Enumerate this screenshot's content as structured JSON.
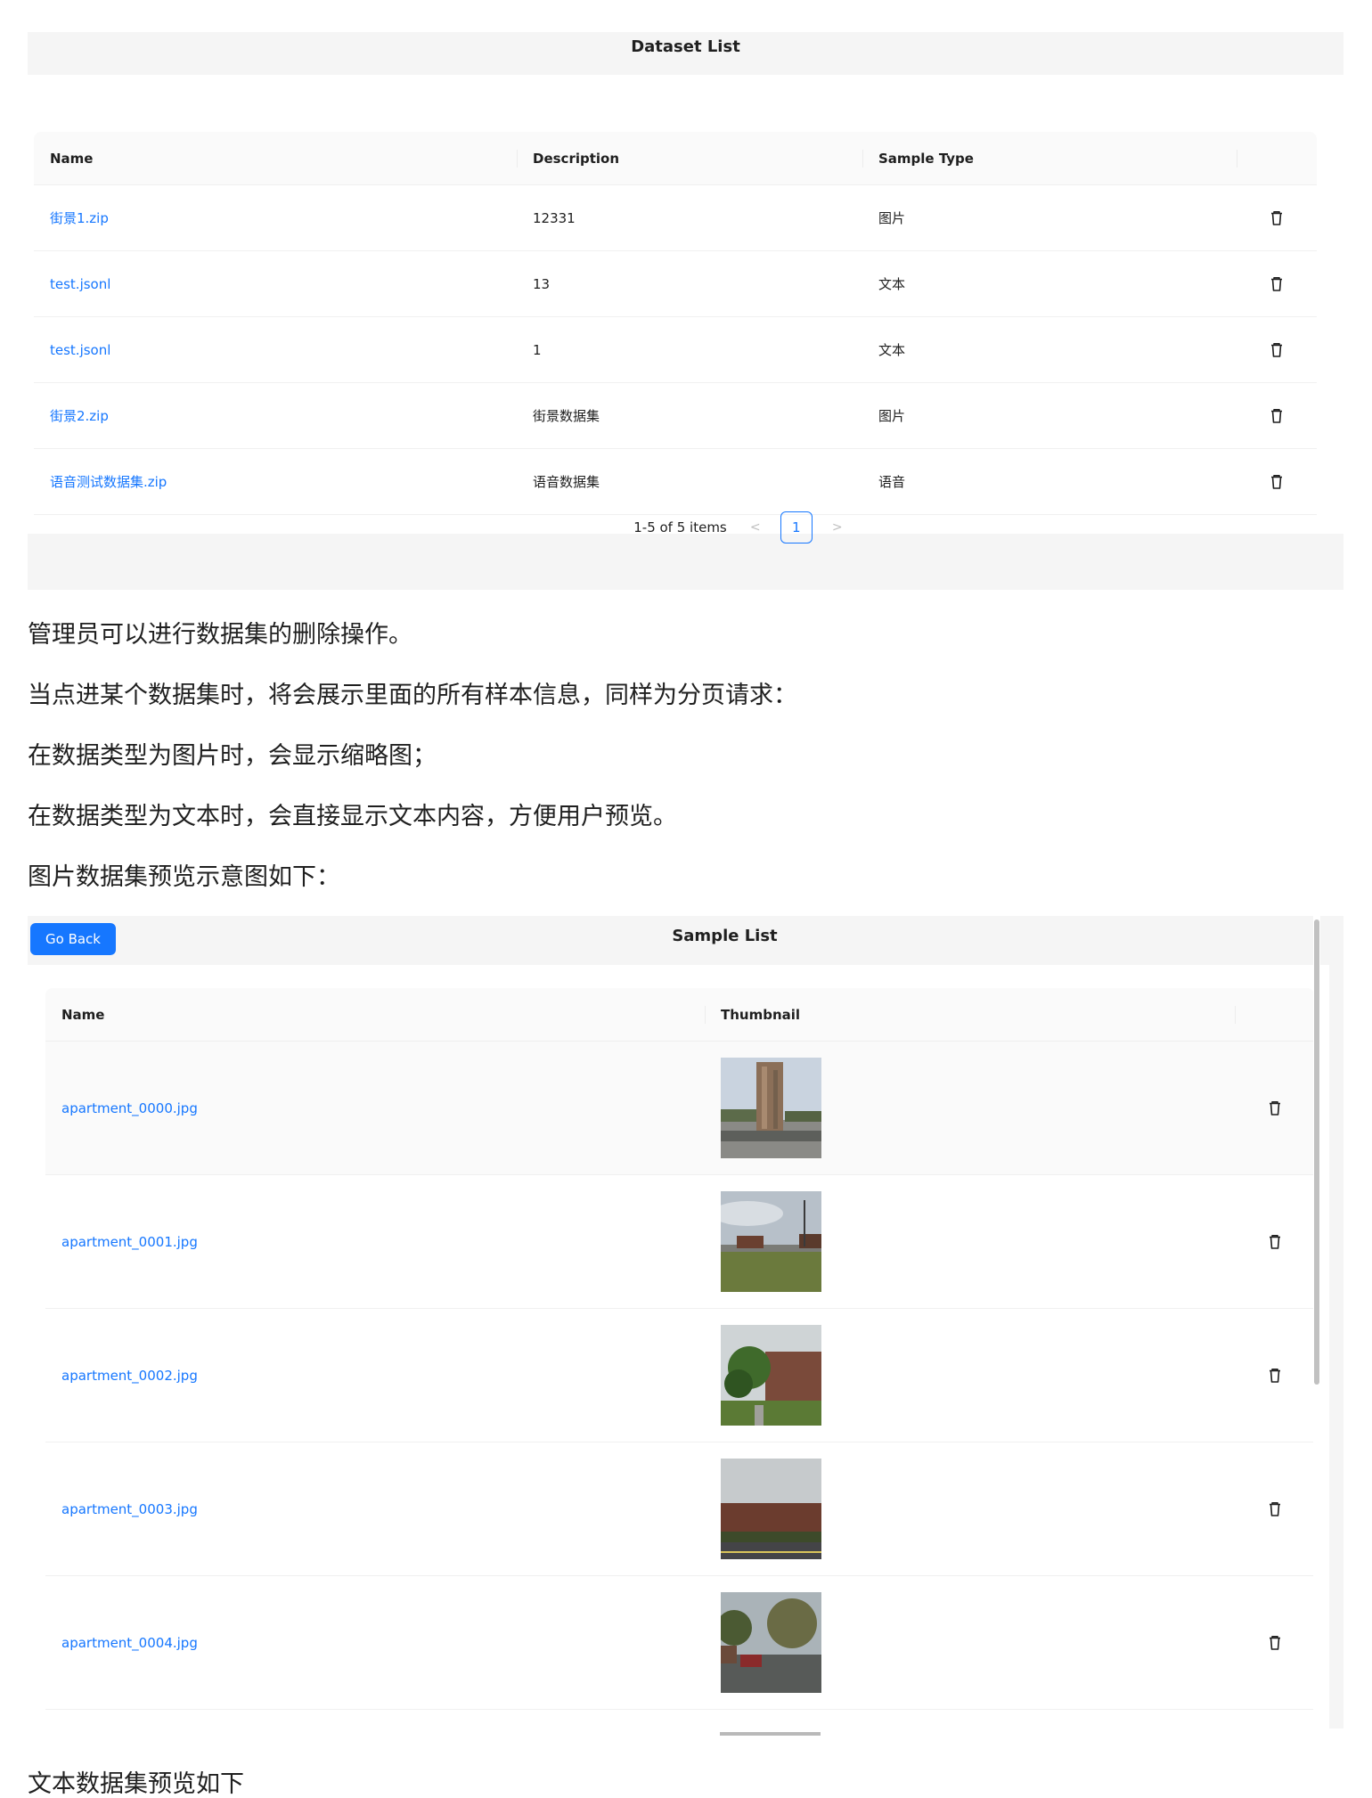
{
  "dataset_list": {
    "title": "Dataset List",
    "columns": [
      "Name",
      "Description",
      "Sample Type"
    ],
    "rows": [
      {
        "name": "街景1.zip",
        "description": "12331",
        "type": "图片"
      },
      {
        "name": "test.jsonl",
        "description": "13",
        "type": "文本"
      },
      {
        "name": "test.jsonl",
        "description": "1",
        "type": "文本"
      },
      {
        "name": "街景2.zip",
        "description": "街景数据集",
        "type": "图片"
      },
      {
        "name": "语音测试数据集.zip",
        "description": "语音数据集",
        "type": "语音"
      }
    ],
    "pagination": {
      "total_text": "1-5 of 5 items",
      "current_page": "1",
      "prev_icon": "chevron-left-icon",
      "next_icon": "chevron-right-icon"
    },
    "row_action_icon": "trash-icon"
  },
  "prose": {
    "p1": "管理员可以进行数据集的删除操作。",
    "p2": "当点进某个数据集时，将会展示里面的所有样本信息，同样为分页请求：",
    "p3": "在数据类型为图片时，会显示缩略图；",
    "p4": "在数据类型为文本时，会直接显示文本内容，方便用户预览。",
    "p5": "图片数据集预览示意图如下：",
    "p6": "文本数据集预览如下"
  },
  "sample_list": {
    "title": "Sample List",
    "go_back_label": "Go Back",
    "columns": [
      "Name",
      "Thumbnail"
    ],
    "rows": [
      {
        "name": "apartment_0000.jpg"
      },
      {
        "name": "apartment_0001.jpg"
      },
      {
        "name": "apartment_0002.jpg"
      },
      {
        "name": "apartment_0003.jpg"
      },
      {
        "name": "apartment_0004.jpg"
      }
    ]
  },
  "colors": {
    "accent": "#1677ff",
    "panel_bg": "#f5f5f5",
    "header_bg": "#fafafa"
  }
}
